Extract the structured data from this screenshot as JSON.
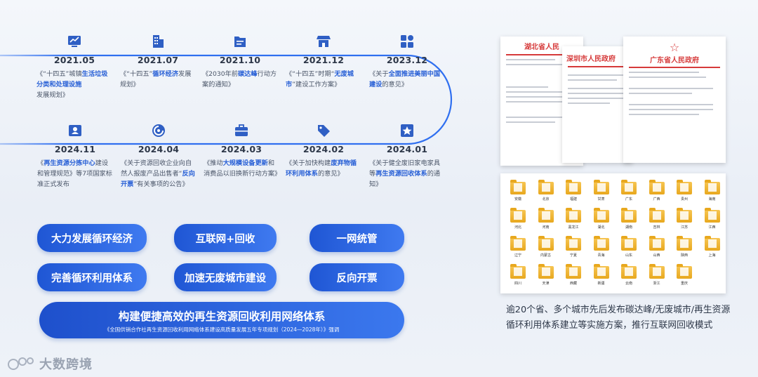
{
  "timeline_top": [
    {
      "year": "2021.05",
      "icon": "chart-icon",
      "parts": [
        [
          "《“十四五”城镇",
          false
        ],
        [
          "生活垃圾分类和处理设施",
          true
        ],
        [
          "发展规划》",
          false
        ]
      ]
    },
    {
      "year": "2021.07",
      "icon": "building-icon",
      "parts": [
        [
          "《“十四五”",
          false
        ],
        [
          "循环经济",
          true
        ],
        [
          "发展规划》",
          false
        ]
      ]
    },
    {
      "year": "2021.10",
      "icon": "document-icon",
      "parts": [
        [
          "《2030年前",
          false
        ],
        [
          "碳达峰",
          true
        ],
        [
          "行动方案的通知》",
          false
        ]
      ]
    },
    {
      "year": "2021.12",
      "icon": "store-icon",
      "parts": [
        [
          "《“十四五”时期“",
          false
        ],
        [
          "无废城市",
          true
        ],
        [
          "”建设工作方案》",
          false
        ]
      ]
    },
    {
      "year": "2023.12",
      "icon": "grid-icon",
      "parts": [
        [
          "《关于",
          false
        ],
        [
          "全面推进美丽中国建设",
          true
        ],
        [
          "的意见》",
          false
        ]
      ]
    }
  ],
  "timeline_bottom": [
    {
      "year": "2024.11",
      "icon": "id-card-icon",
      "parts": [
        [
          "《",
          false
        ],
        [
          "再生资源分拣中心",
          true
        ],
        [
          "建设和管理规范》等7项国家标准正式发布",
          false
        ]
      ]
    },
    {
      "year": "2024.04",
      "icon": "recycle-icon",
      "parts": [
        [
          "《关于资源回收企业向自然人报废产品出售者“",
          false
        ],
        [
          "反向开票",
          true
        ],
        [
          "”有关事项的公告》",
          false
        ]
      ]
    },
    {
      "year": "2024.03",
      "icon": "briefcase-icon",
      "parts": [
        [
          "《推动",
          false
        ],
        [
          "大规模设备更新",
          true
        ],
        [
          "和消费品以旧换新行动方案》",
          false
        ]
      ]
    },
    {
      "year": "2024.02",
      "icon": "tag-icon",
      "parts": [
        [
          "《关于加快构建",
          false
        ],
        [
          "废弃物循环利用体系",
          true
        ],
        [
          "的意见》",
          false
        ]
      ]
    },
    {
      "year": "2024.01",
      "icon": "star-icon",
      "parts": [
        [
          "《关于健全废旧家电家具等",
          false
        ],
        [
          "再生资源回收体系",
          true
        ],
        [
          "的通知》",
          false
        ]
      ]
    }
  ],
  "pills": [
    "大力发展循环经济",
    "互联网+回收",
    "一网统管",
    "完善循环利用体系",
    "加速无废城市建设",
    "反向开票"
  ],
  "banner": {
    "title": "构建便捷高效的再生资源回收利用网络体系",
    "subtitle": "《全国供销合作社再生资源回收利用网络体系建设高质量发展五年专项规划（2024—2028年）》强调"
  },
  "docs": {
    "hubei_title": "湖北省人民",
    "shenzhen_title": "深圳市人民政府",
    "guangdong_title": "广东省人民政府"
  },
  "folders": [
    "安徽",
    "北京",
    "福建",
    "甘肃",
    "广东",
    "广西",
    "贵州",
    "海南",
    "河北",
    "河南",
    "黑龙江",
    "湖北",
    "湖南",
    "吉林",
    "江苏",
    "江西",
    "辽宁",
    "内蒙古",
    "宁夏",
    "青海",
    "山东",
    "山西",
    "陕西",
    "上海",
    "四川",
    "天津",
    "西藏",
    "新疆",
    "云南",
    "浙江",
    "重庆"
  ],
  "caption": "逾20个省、多个城市先后发布碳达峰/无废城市/再生资源循环利用体系建立等实施方案，推行互联网回收模式",
  "logo": "大数跨境",
  "colors": {
    "accent": "#2a61d6",
    "line": "#2f6ff0"
  }
}
